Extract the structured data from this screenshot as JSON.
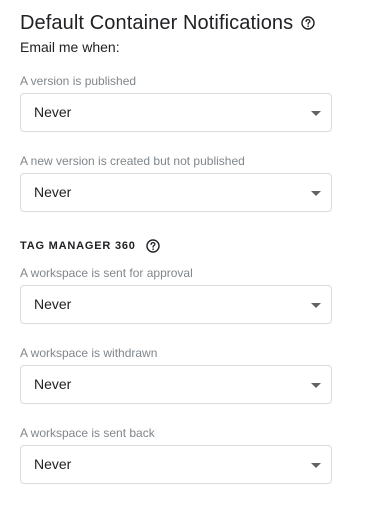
{
  "header": {
    "title": "Default Container Notifications",
    "subtitle": "Email me when:",
    "help_icon": "help-circle-icon"
  },
  "fields": [
    {
      "label": "A version is published",
      "value": "Never"
    },
    {
      "label": "A new version is created but not published",
      "value": "Never"
    }
  ],
  "section": {
    "heading": "TAG MANAGER 360",
    "help_icon": "help-circle-icon"
  },
  "section_fields": [
    {
      "label": "A workspace is sent for approval",
      "value": "Never"
    },
    {
      "label": "A workspace is withdrawn",
      "value": "Never"
    },
    {
      "label": "A workspace is sent back",
      "value": "Never"
    }
  ]
}
